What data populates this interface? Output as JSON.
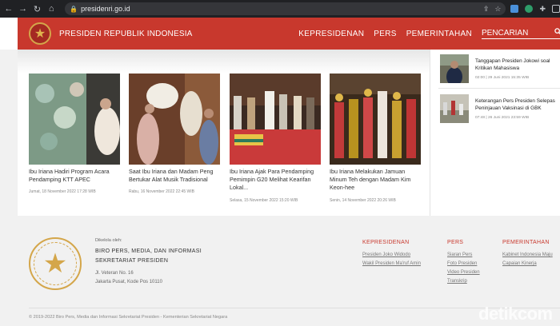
{
  "browser": {
    "url": "presidenri.go.id"
  },
  "header": {
    "site_title": "PRESIDEN REPUBLIK INDONESIA",
    "menu": [
      "KEPRESIDENAN",
      "PERS",
      "PEMERINTAHAN"
    ],
    "search_label": "PENCARIAN",
    "brand_color": "#c8382d"
  },
  "articles": [
    {
      "title": "Ibu Iriana Hadiri Program Acara Pendamping KTT APEC",
      "date": "Jumat, 18 November 2022 17:28 WIB"
    },
    {
      "title": "Saat Ibu Iriana dan Madam Peng Bertukar Alat Musik Tradisional",
      "date": "Rabu, 16 November 2022 22:45 WIB"
    },
    {
      "title": "Ibu Iriana Ajak Para Pendamping Pemimpin G20 Melihat Kearifan Lokal...",
      "date": "Selasa, 15 November 2022 15:20 WIB"
    },
    {
      "title": "Ibu Iriana Melakukan Jamuan Minum Teh dengan Madam Kim Keon-hee",
      "date": "Senin, 14 November 2022 20:26 WIB"
    }
  ],
  "side_news": [
    {
      "title": "Tanggapan Presiden Jokowi soal Kritikan Mahasiswa",
      "duration": "02:00",
      "date": "29 Juni 2021 15:35 WIB"
    },
    {
      "title": "Keterangan Pers Presiden Selepas Peninjauan Vaksinasi di GBK",
      "duration": "07:48",
      "date": "26 Juni 2021 23:59 WIB"
    }
  ],
  "footer": {
    "managed_by": "Dikelola oleh:",
    "org_line1": "BIRO PERS, MEDIA, DAN INFORMASI",
    "org_line2": "SEKRETARIAT PRESIDEN",
    "address1": "Jl. Veteran No. 16",
    "address2": "Jakarta Pusat, Kode Pos 10110",
    "columns": [
      {
        "heading": "KEPRESIDENAN",
        "links": [
          "Presiden Joko Widodo",
          "Wakil Presiden Ma'ruf Amin"
        ]
      },
      {
        "heading": "PERS",
        "links": [
          "Siaran Pers",
          "Foto Presiden",
          "Video Presiden",
          "Transkrip"
        ]
      },
      {
        "heading": "PEMERINTAHAN",
        "links": [
          "Kabinet Indonesia Maju",
          "Capaian Kinerja"
        ]
      }
    ],
    "copyright": "© 2019-2022 Biro Pers, Media dan Informasi Sekretariat Presiden - Kementerian Sekretariat Negara"
  },
  "watermark": "detikcom"
}
